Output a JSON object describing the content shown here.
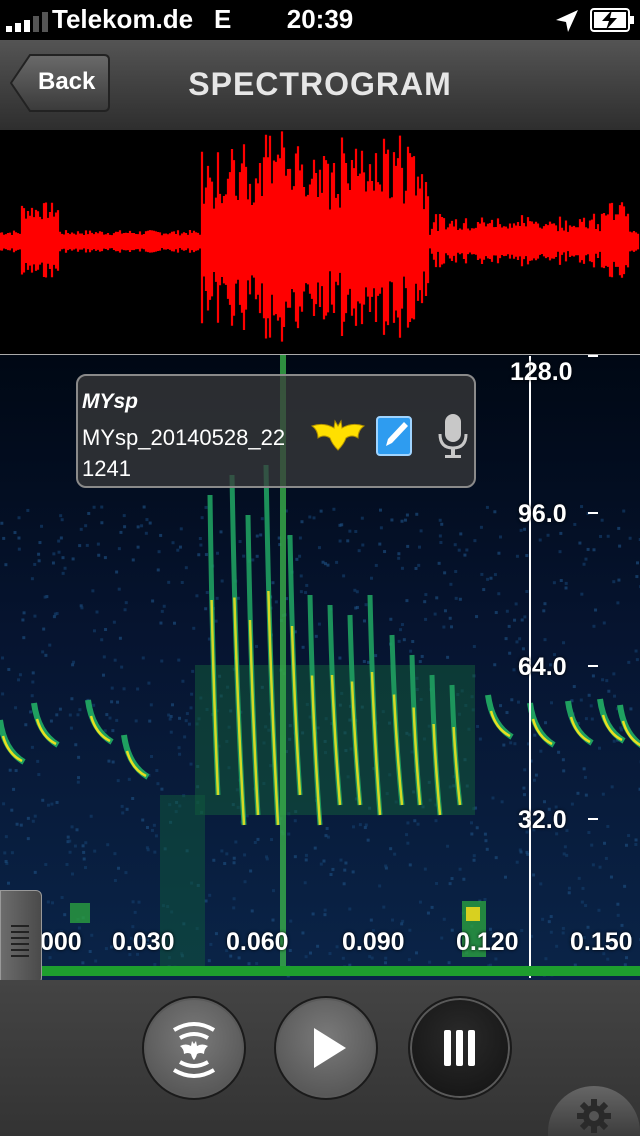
{
  "status_bar": {
    "carrier": "Telekom.de",
    "network": "E",
    "time": "20:39"
  },
  "nav_bar": {
    "back_label": "Back",
    "title": "SPECTROGRAM"
  },
  "recording_card": {
    "species": "MYsp",
    "file_name": "MYsp_20140528_221241",
    "icons": [
      "bat-icon",
      "edit-icon",
      "microphone-icon"
    ]
  },
  "frequency_axis": {
    "ticks": [
      "128.0",
      "96.0",
      "64.0",
      "32.0"
    ]
  },
  "time_axis": {
    "ticks": [
      "000",
      "0.030",
      "0.060",
      "0.090",
      "0.120",
      "0.150"
    ]
  },
  "toolbar": {
    "buttons": [
      "bat-detect-button",
      "play-button",
      "menu-button",
      "settings-button"
    ]
  },
  "colors": {
    "waveform": "#ff0000",
    "spectrogram_low": "#0a1a3a",
    "spectrogram_mid": "#1fa060",
    "spectrogram_high": "#e8e020",
    "bat_icon": "#ffe000",
    "edit_icon": "#2e9cf0",
    "timeline_bar": "#1e9e2e"
  }
}
